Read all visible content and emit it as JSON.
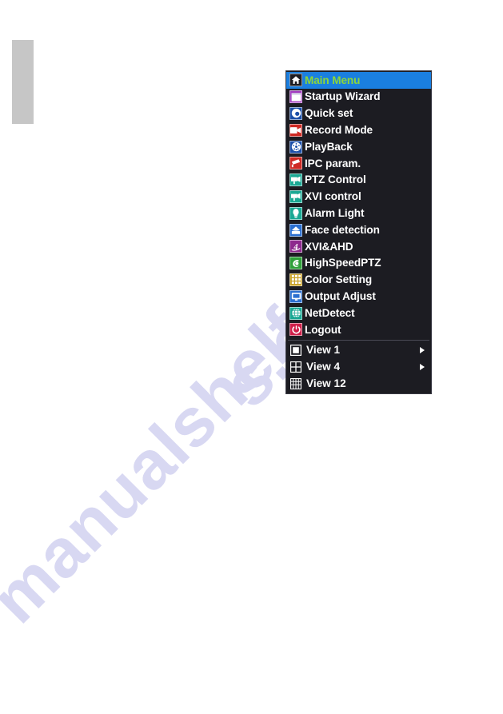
{
  "page": {
    "background_color": "#ffffff",
    "watermark_color": "#d8d8f2",
    "watermark_line_1": "manualshelf",
    "watermark_line_2": "s.com"
  },
  "menu": {
    "panel_bg": "#1c1c22",
    "selected_bg": "#1a7fe0",
    "selected_text_color": "#8cd63a",
    "text_color": "#ffffff",
    "items": [
      {
        "label": "Main Menu",
        "icon": "home-icon",
        "icon_color": "#1c1c22",
        "selected": true
      },
      {
        "label": "Startup Wizard",
        "icon": "wizard-window-icon",
        "icon_color": "#a23bbf",
        "selected": false
      },
      {
        "label": "Quick set",
        "icon": "quick-set-icon",
        "icon_color": "#1c4fa8",
        "selected": false
      },
      {
        "label": "Record Mode",
        "icon": "video-camera-icon",
        "icon_color": "#cf2a24",
        "selected": false
      },
      {
        "label": "PlayBack",
        "icon": "playback-disc-icon",
        "icon_color": "#1c4fa8",
        "selected": false
      },
      {
        "label": "IPC param.",
        "icon": "ipc-camera-icon",
        "icon_color": "#cf2a24",
        "selected": false
      },
      {
        "label": "PTZ Control",
        "icon": "ptz-camera-icon",
        "icon_color": "#1aa894",
        "selected": false
      },
      {
        "label": "XVI control",
        "icon": "ptz-camera-icon",
        "icon_color": "#1aa894",
        "selected": false
      },
      {
        "label": "Alarm Light",
        "icon": "alarm-light-icon",
        "icon_color": "#1aa894",
        "selected": false
      },
      {
        "label": "Face detection",
        "icon": "face-detection-icon",
        "icon_color": "#2b6fd0",
        "selected": false
      },
      {
        "label": "XVI&AHD",
        "icon": "xvi-ahd-icon",
        "icon_color": "#8e2a8e",
        "selected": false
      },
      {
        "label": "HighSpeedPTZ",
        "icon": "high-speed-ptz-icon",
        "icon_color": "#2fa03a",
        "selected": false
      },
      {
        "label": "Color Setting",
        "icon": "color-grid-icon",
        "icon_color": "#c9a227",
        "selected": false
      },
      {
        "label": "Output Adjust",
        "icon": "monitor-icon",
        "icon_color": "#2b6fd0",
        "selected": false
      },
      {
        "label": "NetDetect",
        "icon": "net-detect-globe-icon",
        "icon_color": "#1aa894",
        "selected": false
      },
      {
        "label": "Logout",
        "icon": "power-icon",
        "icon_color": "#cf1f4a",
        "selected": false
      }
    ],
    "view_items": [
      {
        "label": "View 1",
        "icon": "view-grid-1-icon",
        "has_submenu": true
      },
      {
        "label": "View 4",
        "icon": "view-grid-4-icon",
        "has_submenu": true
      },
      {
        "label": "View 12",
        "icon": "view-grid-12-icon",
        "has_submenu": false
      }
    ]
  }
}
